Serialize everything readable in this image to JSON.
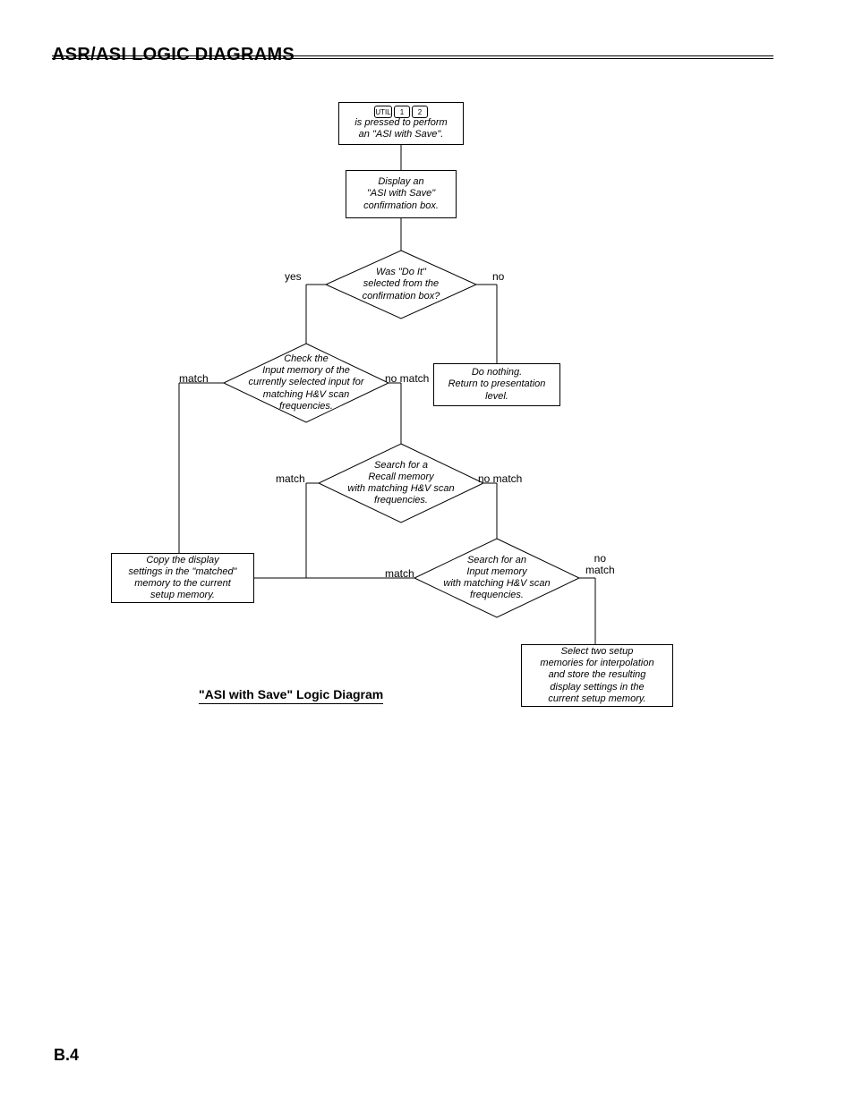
{
  "header": {
    "title": "ASR/ASI LOGIC DIAGRAMS"
  },
  "footer": {
    "page": "B.4"
  },
  "caption": {
    "text": "\"ASI with Save\" Logic Diagram"
  },
  "keys": {
    "util": "UTIL",
    "k1": "1",
    "k2": "2"
  },
  "nodes": {
    "start": "is pressed to perform\nan \"ASI with Save\".",
    "confirm": "Display an\n\"ASI with Save\"\nconfirmation box.",
    "doit": "Was \"Do It\"\nselected from the\nconfirmation box?",
    "nothing": "Do nothing.\nReturn to presentation\nlevel.",
    "checkInput": "Check the\nInput memory of the\ncurrently selected input for\nmatching H&V scan\nfrequencies.",
    "recall": "Search for a\nRecall memory\nwith matching H&V scan\nfrequencies.",
    "copy": "Copy the display\nsettings in the \"matched\"\nmemory to the current\nsetup memory.",
    "searchInput": "Search for an\nInput memory\nwith matching H&V scan\nfrequencies.",
    "interp": "Select two setup\nmemories for interpolation\nand store the resulting\ndisplay settings in the\ncurrent setup memory."
  },
  "labels": {
    "yes": "yes",
    "no": "no",
    "match": "match",
    "nomatch": "no match",
    "no_ln1": "no",
    "no_ln2": "match"
  }
}
